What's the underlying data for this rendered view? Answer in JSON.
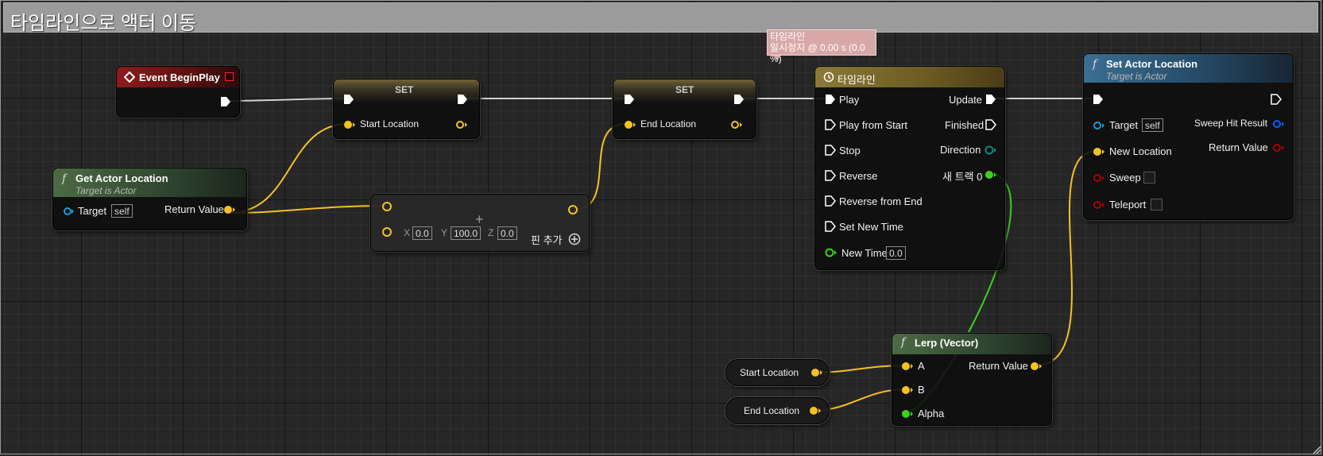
{
  "comment": {
    "title": "타임라인으로 액터 이동"
  },
  "colors": {
    "exec": "#ffffff",
    "vector": "#f5c122",
    "object": "#1a9ad9",
    "float": "#3bd11f",
    "bool": "#8c0000",
    "struct": "#0060ff",
    "comment_bar": "#9b9b9b"
  },
  "event_begin_play": {
    "title": "Event BeginPlay",
    "icon": "event-diamond-icon"
  },
  "get_actor_location": {
    "title": "Get Actor Location",
    "subtitle": "Target is Actor",
    "target_label": "Target",
    "target_value": "self",
    "return_label": "Return Value"
  },
  "set_start": {
    "title": "SET",
    "var_label": "Start Location"
  },
  "set_end": {
    "title": "SET",
    "var_label": "End Location"
  },
  "add_node": {
    "x_label": "X",
    "x_value": "0.0",
    "y_label": "Y",
    "y_value": "100.0",
    "z_label": "Z",
    "z_value": "0.0",
    "add_pin_label": "핀 추가",
    "operator_symbol": "+"
  },
  "timeline_tooltip": {
    "line1": "타임라인",
    "line2": "일시정지 @ 0.00 s (0.0 %)"
  },
  "timeline": {
    "title": "타임라인",
    "inputs": [
      "Play",
      "Play from Start",
      "Stop",
      "Reverse",
      "Reverse from End",
      "Set New Time"
    ],
    "new_time_label": "New Time",
    "new_time_value": "0.0",
    "outputs": {
      "update": "Update",
      "finished": "Finished",
      "direction": "Direction",
      "track": "새 트랙 0"
    }
  },
  "set_actor_location": {
    "title": "Set Actor Location",
    "subtitle": "Target is Actor",
    "target_label": "Target",
    "target_value": "self",
    "new_location_label": "New Location",
    "sweep_label": "Sweep",
    "teleport_label": "Teleport",
    "sweep_hit_label": "Sweep Hit Result",
    "return_label": "Return Value"
  },
  "lerp": {
    "title": "Lerp (Vector)",
    "a_label": "A",
    "b_label": "B",
    "alpha_label": "Alpha",
    "return_label": "Return Value"
  },
  "var_start": {
    "label": "Start Location"
  },
  "var_end": {
    "label": "End Location"
  }
}
